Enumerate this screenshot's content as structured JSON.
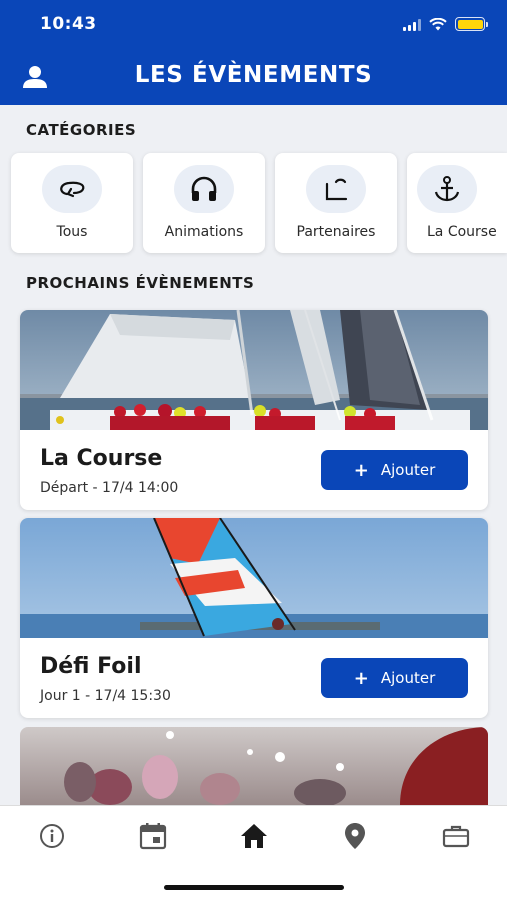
{
  "status_bar": {
    "time": "10:43",
    "battery_color": "#ffd60a"
  },
  "header": {
    "title": "LES ÉVÈNEMENTS",
    "profile_icon": "user-icon",
    "background": "#0a46b8"
  },
  "categories": {
    "title": "CATÉGORIES",
    "items": [
      {
        "label": "Tous",
        "icon": "refresh-icon"
      },
      {
        "label": "Animations",
        "icon": "headphones-icon"
      },
      {
        "label": "Partenaires",
        "icon": "partners-icon"
      },
      {
        "label": "La Course",
        "icon": "anchor-icon"
      }
    ]
  },
  "events": {
    "title": "PROCHAINS ÉVÈNEMENTS",
    "items": [
      {
        "name": "La Course",
        "date": "Départ - 17/4 14:00",
        "button": "Ajouter",
        "image": "sailing-photo"
      },
      {
        "name": "Défi Foil",
        "date": "Jour 1 - 17/4 15:30",
        "button": "Ajouter",
        "image": "windsurf-photo"
      }
    ]
  },
  "tabbar": {
    "items": [
      {
        "icon": "info-icon"
      },
      {
        "icon": "calendar-icon"
      },
      {
        "icon": "home-icon",
        "active": true
      },
      {
        "icon": "location-pin-icon"
      },
      {
        "icon": "briefcase-icon"
      }
    ]
  }
}
